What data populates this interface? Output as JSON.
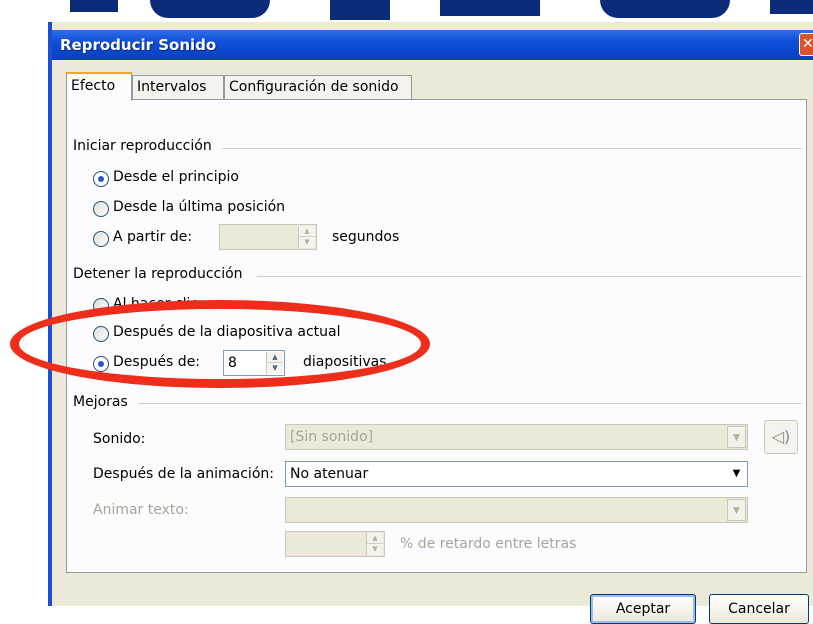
{
  "window": {
    "title": "Reproducir Sonido",
    "close_glyph": "✕"
  },
  "tabs": [
    {
      "label": "Efecto",
      "active": true
    },
    {
      "label": "Intervalos",
      "active": false
    },
    {
      "label": "Configuración de sonido",
      "active": false
    }
  ],
  "start_group": {
    "label": "Iniciar reproducción",
    "options": [
      {
        "label": "Desde el principio",
        "checked": true
      },
      {
        "label": "Desde la última posición",
        "checked": false
      },
      {
        "label": "A partir de:",
        "checked": false
      }
    ],
    "seconds_value": "",
    "seconds_unit": "segundos"
  },
  "stop_group": {
    "label": "Detener la reproducción",
    "options": [
      {
        "label": "Al hacer clic",
        "checked": false
      },
      {
        "label": "Después de la diapositiva actual",
        "checked": false
      },
      {
        "label": "Después de:",
        "checked": true
      }
    ],
    "slides_value": "8",
    "slides_unit": "diapositivas"
  },
  "enhance_group": {
    "label": "Mejoras",
    "sound_label": "Sonido:",
    "sound_value": "[Sin sonido]",
    "after_anim_label": "Después de la animación:",
    "after_anim_value": "No atenuar",
    "animate_text_label": "Animar texto:",
    "animate_text_value": "",
    "delay_value": "",
    "delay_label": "% de retardo entre letras"
  },
  "buttons": {
    "ok": "Aceptar",
    "cancel": "Cancelar"
  },
  "icons": {
    "spin_up": "▲",
    "spin_down": "▼",
    "dropdown": "▼",
    "speaker": "◁)"
  },
  "colors": {
    "titlebar": "#0a47cc",
    "dialog_bg": "#ece9d8",
    "panel_bg": "#fcfcfe",
    "annotation": "#ee2d1a",
    "active_tab_accent": "#f5a623"
  }
}
